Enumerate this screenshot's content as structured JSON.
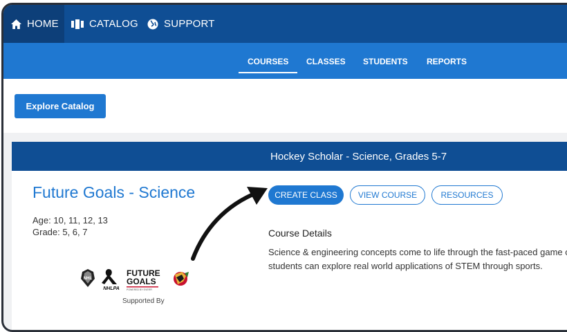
{
  "topbar": {
    "items": [
      {
        "label": "HOME",
        "icon": "home-icon",
        "active": true
      },
      {
        "label": "CATALOG",
        "icon": "catalog-icon",
        "active": false
      },
      {
        "label": "SUPPORT",
        "icon": "globe-icon",
        "active": false
      }
    ]
  },
  "subnav": {
    "tabs": [
      {
        "label": "COURSES",
        "active": true
      },
      {
        "label": "CLASSES",
        "active": false
      },
      {
        "label": "STUDENTS",
        "active": false
      },
      {
        "label": "REPORTS",
        "active": false
      }
    ]
  },
  "toolbar": {
    "explore_label": "Explore Catalog"
  },
  "course": {
    "header": "Hockey Scholar - Science, Grades 5-7",
    "title": "Future Goals - Science",
    "age": "Age: 10, 11, 12, 13",
    "grade": "Grade: 5, 6, 7",
    "buttons": {
      "create": "CREATE CLASS",
      "view": "VIEW COURSE",
      "resources": "RESOURCES"
    },
    "details_heading": "Course Details",
    "details_line1": "Science & engineering concepts come to life through the fast-paced game of",
    "details_line2": "students can explore real world applications of STEM through sports.",
    "supported_by": "Supported By",
    "logos": {
      "nhl": "NHL",
      "nhlpa": "NHLPA",
      "future_goals_line1": "FUTURE",
      "future_goals_line2": "GOALS",
      "future_goals_tagline": "POWERED BY EVERFI",
      "blackhawks_icon": "blackhawks-icon"
    }
  },
  "colors": {
    "navy": "#0f4e94",
    "blue": "#1f78d1",
    "teal": "#35a3a8"
  }
}
